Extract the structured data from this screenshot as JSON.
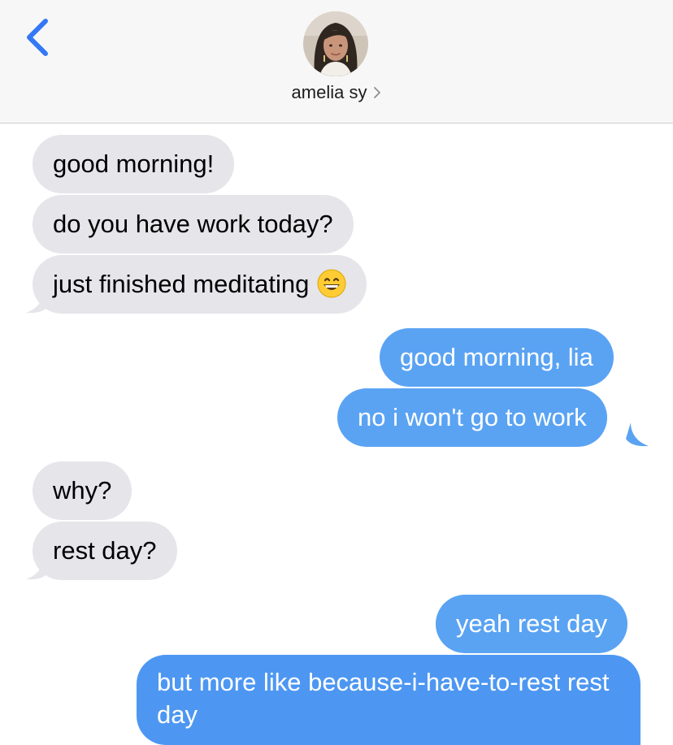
{
  "header": {
    "contact_name": "amelia sy"
  },
  "icons": {
    "back": "chevron-left-icon",
    "contact_chevron": "chevron-right-icon",
    "emoji": "grinning-face-emoji"
  },
  "colors": {
    "header_bg": "#f7f7f7",
    "incoming_bubble": "#e5e5ea",
    "outgoing_bubble": "#5aa3f3",
    "accent": "#3478f6"
  },
  "messages": [
    {
      "direction": "incoming",
      "text": "good morning!"
    },
    {
      "direction": "incoming",
      "text": "do you have work today?"
    },
    {
      "direction": "incoming",
      "text": "just finished meditating",
      "emoji": "😄"
    },
    {
      "direction": "outgoing",
      "text": "good morning, lia"
    },
    {
      "direction": "outgoing",
      "text": "no i won't go to work"
    },
    {
      "direction": "incoming",
      "text": "why?"
    },
    {
      "direction": "incoming",
      "text": "rest day?"
    },
    {
      "direction": "outgoing",
      "text": "yeah rest day"
    },
    {
      "direction": "outgoing",
      "text": "but more like because-i-have-to-rest rest day"
    }
  ]
}
